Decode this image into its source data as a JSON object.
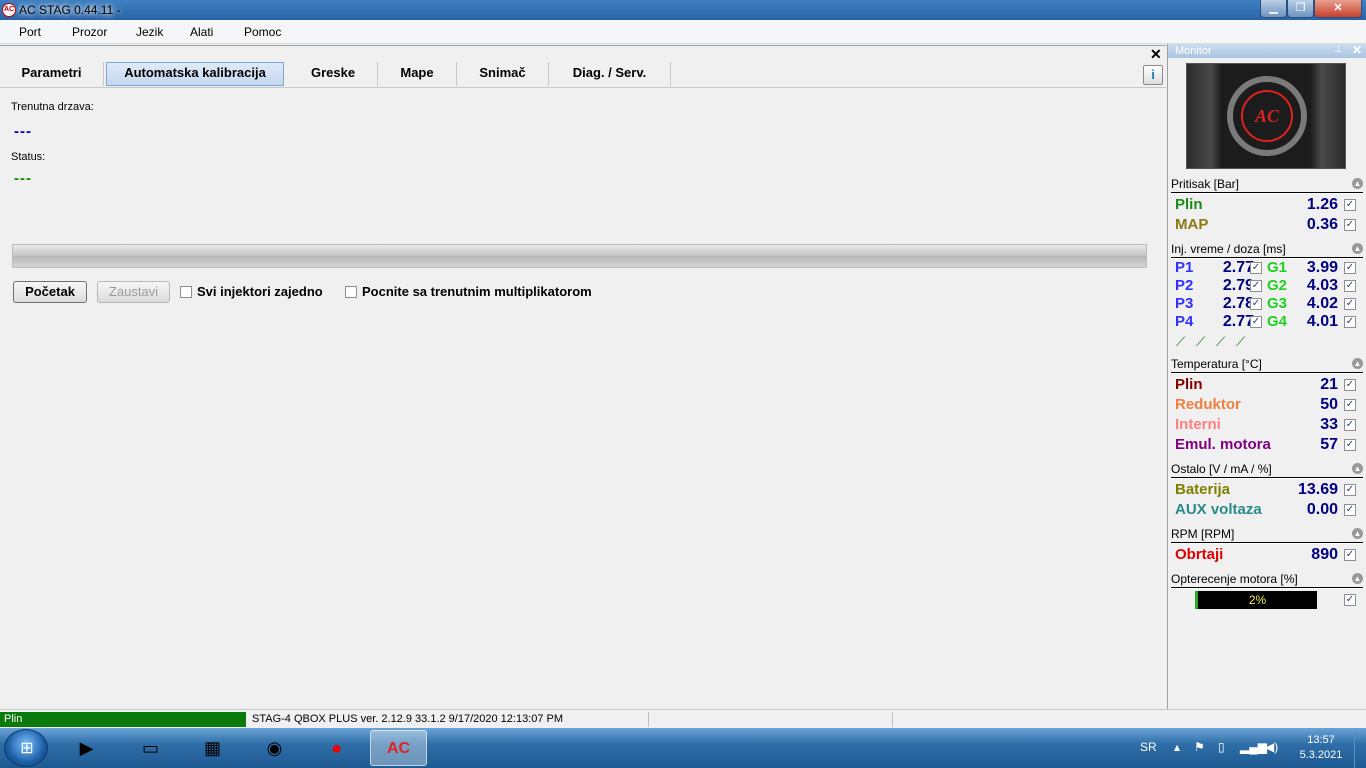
{
  "window": {
    "title": "AC STAG 0.44.11 -",
    "icon": "ac-logo-icon"
  },
  "menu": [
    "Port",
    "Prozor",
    "Jezik",
    "Alati",
    "Pomoc"
  ],
  "tabs": [
    "Parametri",
    "Automatska kalibracija",
    "Greske",
    "Mape",
    "Snimač",
    "Diag. / Serv."
  ],
  "active_tab": "Automatska kalibracija",
  "calibration": {
    "current_state_label": "Trenutna drzava:",
    "current_state_value": "---",
    "status_label": "Status:",
    "status_value": "---",
    "start_button": "Početak",
    "stop_button": "Zaustavi",
    "all_injectors_label": "Svi injektori zajedno",
    "all_injectors_checked": false,
    "start_multiplier_label": "Pocnite sa trenutnim multiplikatorom",
    "start_multiplier_checked": false
  },
  "monitor": {
    "title": "Monitor",
    "pressure": {
      "header": "Pritisak [Bar]",
      "plin_label": "Plin",
      "plin_value": "1.26",
      "map_label": "MAP",
      "map_value": "0.36"
    },
    "injection": {
      "header": "Inj. vreme / doza [ms]",
      "rows": [
        {
          "p": "P1",
          "pv": "2.77",
          "g": "G1",
          "gv": "3.99"
        },
        {
          "p": "P2",
          "pv": "2.79",
          "g": "G2",
          "gv": "4.03"
        },
        {
          "p": "P3",
          "pv": "2.78",
          "g": "G3",
          "gv": "4.02"
        },
        {
          "p": "P4",
          "pv": "2.77",
          "g": "G4",
          "gv": "4.01"
        }
      ]
    },
    "temperature": {
      "header": "Temperatura [°C]",
      "plin_label": "Plin",
      "plin_value": "21",
      "reduktor_label": "Reduktor",
      "reduktor_value": "50",
      "interni_label": "Interni",
      "interni_value": "33",
      "emul_label": "Emul. motora",
      "emul_value": "57"
    },
    "other": {
      "header": "Ostalo [V / mA / %]",
      "baterija_label": "Baterija",
      "baterija_value": "13.69",
      "aux_label": "AUX voltaza",
      "aux_value": "0.00"
    },
    "rpm": {
      "header": "RPM [RPM]",
      "obrtaji_label": "Obrtaji",
      "obrtaji_value": "890"
    },
    "load": {
      "header": "Opterecenje motora [%]",
      "value_text": "2%",
      "value": 2
    }
  },
  "statusbar": {
    "fuel": "Plin",
    "info": "STAG-4 QBOX PLUS  ver. 2.12.9  33.1.2  9/17/2020 12:13:07 PM"
  },
  "taskbar": {
    "lang": "SR",
    "time": "13:57",
    "date": "5.3.2021"
  },
  "colors": {
    "plin_green": "#1a8a1a",
    "map_olive": "#8a7a10",
    "p_blue": "#3030ff",
    "g_green": "#20d020",
    "temp_plin": "#800000",
    "reduktor": "#f08040",
    "interni": "#ff8080",
    "emul": "#800080",
    "baterija": "#808000",
    "aux": "#2a8a8a",
    "obrtaji": "#e00000",
    "value_navy": "#000080"
  }
}
